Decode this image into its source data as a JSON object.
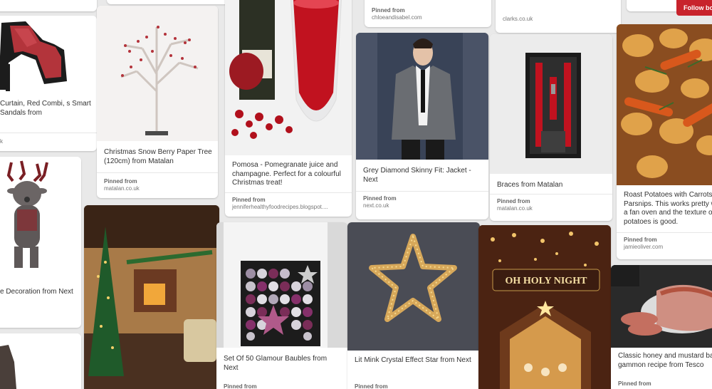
{
  "header": {
    "follow_label": "Follow bo"
  },
  "pins": {
    "sandals": {
      "desc": "Curtain, Red Combi, s Smart Sandals from",
      "src_label": "",
      "src": "k"
    },
    "reindeer": {
      "desc": "e Decoration from Next"
    },
    "tree": {
      "desc": "Christmas Snow Berry Paper Tree (120cm) from Matalan",
      "src_label": "Pinned from",
      "src": "matalan.co.uk"
    },
    "pomosa": {
      "desc": "Pomosa - Pomegranate juice and champagne. Perfect for a colourful Christmas treat!",
      "src_label": "Pinned from",
      "src": "jenniferhealthyfoodrecipes.blogspot...."
    },
    "chloe": {
      "src_label": "Pinned from",
      "src": "chloeandisabel.com"
    },
    "jacket": {
      "desc": "Grey Diamond Skinny Fit: Jacket - Next",
      "src_label": "Pinned from",
      "src": "next.co.uk"
    },
    "clarks": {
      "src": "clarks.co.uk"
    },
    "braces": {
      "desc": "Braces from Matalan",
      "src_label": "Pinned from",
      "src": "matalan.co.uk"
    },
    "potatoes": {
      "desc": "Roast Potatoes with Carrots Parsnips. This works pretty w a fan oven and the texture of potatoes is good.",
      "src_label": "Pinned from",
      "src": "jamieoliver.com"
    },
    "baubles": {
      "desc": "Set Of 50 Glamour Baubles from Next",
      "src_label": "Pinned from"
    },
    "star": {
      "desc": "Lit Mink Crystal Effect Star from Next",
      "src_label": "Pinned from"
    },
    "nativity": {
      "sign_text": "OH HOLY NIGHT"
    },
    "gammon": {
      "desc": "Classic honey and mustard bak gammon recipe from Tesco",
      "src_label": "Pinned from"
    }
  }
}
